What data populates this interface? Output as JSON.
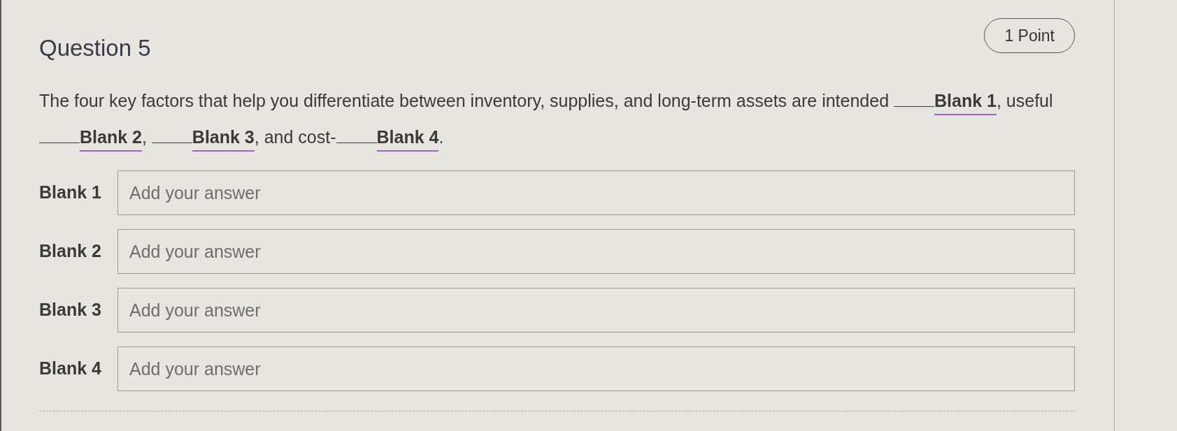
{
  "question": {
    "title": "Question 5",
    "points": "1 Point",
    "segments": [
      {
        "kind": "text",
        "text": "The four key factors that help you differentiate between inventory, supplies, and long-term assets are intended "
      },
      {
        "kind": "blank",
        "label": "Blank 1"
      },
      {
        "kind": "text",
        "text": ", useful "
      },
      {
        "kind": "blank",
        "label": "Blank 2"
      },
      {
        "kind": "text",
        "text": ", "
      },
      {
        "kind": "blank",
        "label": "Blank 3"
      },
      {
        "kind": "text",
        "text": ", and cost-"
      },
      {
        "kind": "blank",
        "label": "Blank 4"
      },
      {
        "kind": "text",
        "text": "."
      }
    ]
  },
  "answers": [
    {
      "label": "Blank 1",
      "placeholder": "Add your answer"
    },
    {
      "label": "Blank 2",
      "placeholder": "Add your answer"
    },
    {
      "label": "Blank 3",
      "placeholder": "Add your answer"
    },
    {
      "label": "Blank 4",
      "placeholder": "Add your answer"
    }
  ]
}
